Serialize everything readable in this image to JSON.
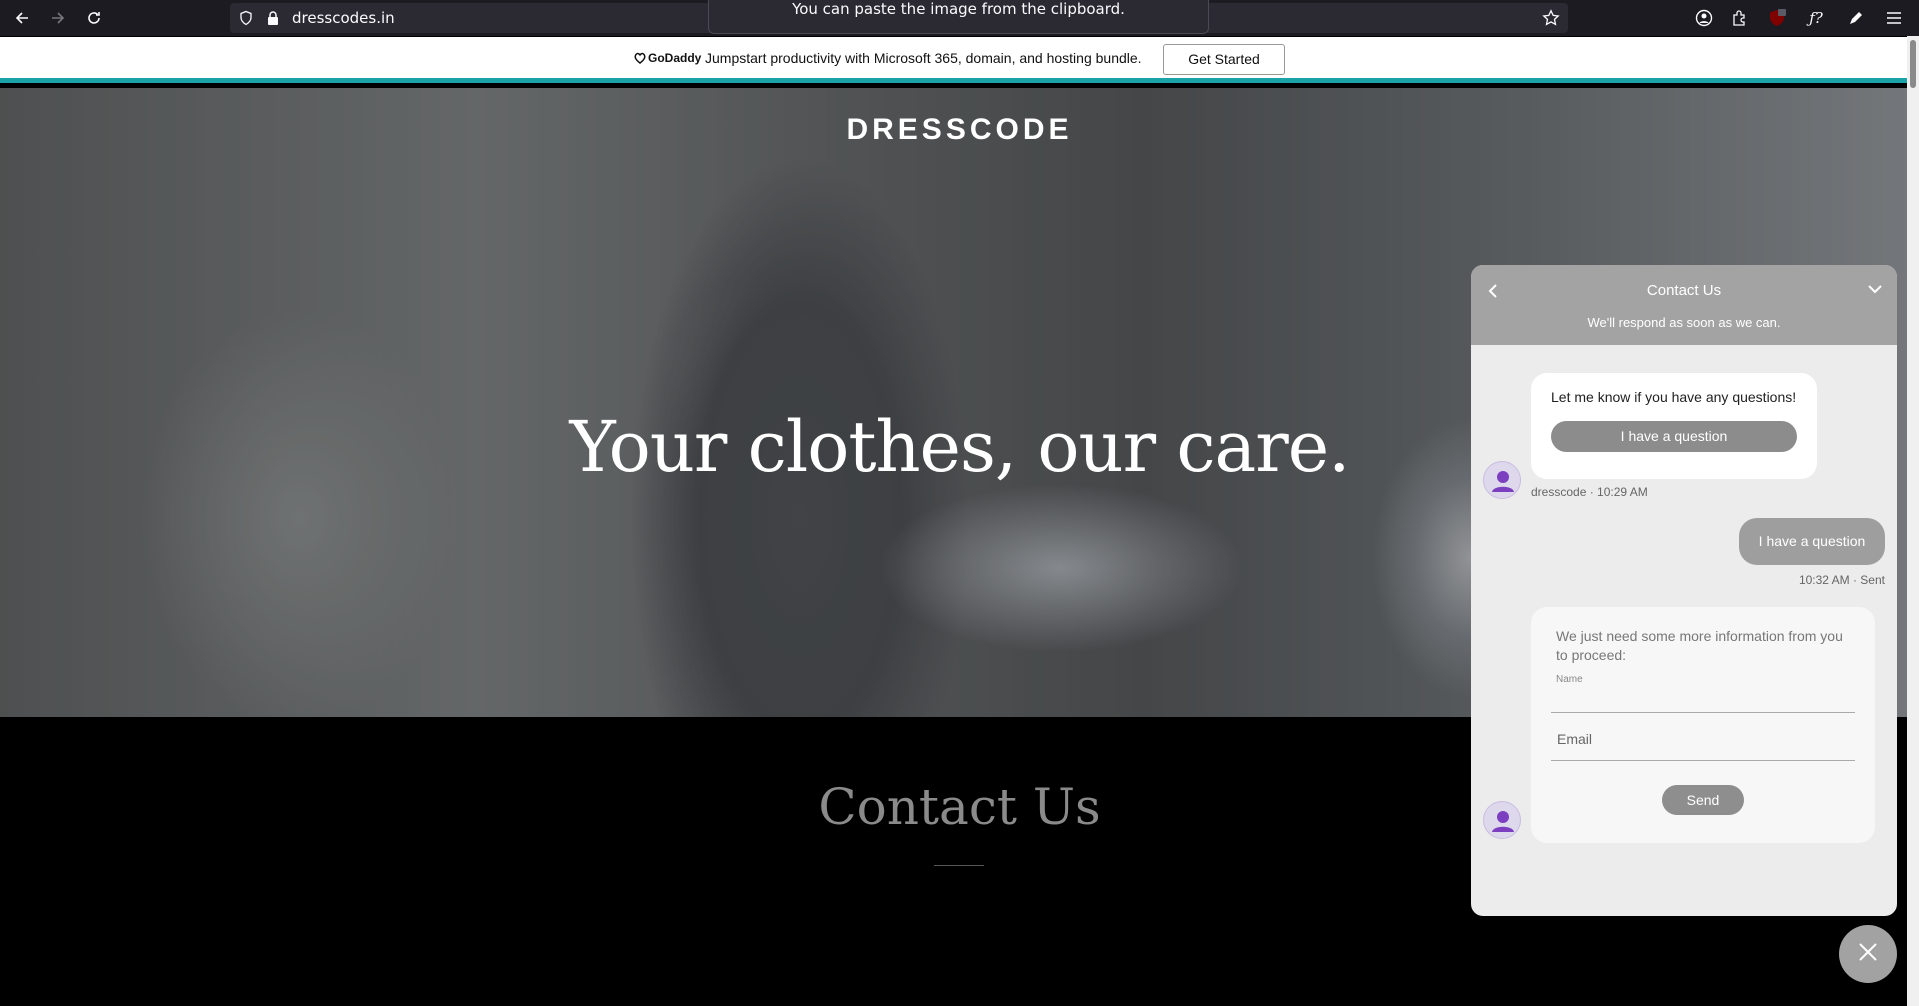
{
  "browser": {
    "url": "dresscodes.in",
    "clipboard_toast": "You can paste the image from the clipboard."
  },
  "promo": {
    "logo_text": "GoDaddy",
    "message": "Jumpstart productivity with Microsoft 365, domain, and hosting bundle.",
    "button_label": "Get Started",
    "accent_color": "#1ba3a8"
  },
  "site": {
    "brand": "DRESSCODE",
    "tagline": "Your clothes, our care.",
    "contact_heading": "Contact Us"
  },
  "chat": {
    "header_title": "Contact Us",
    "header_subtitle": "We'll respond as soon as we can.",
    "bot_message": "Let me know if you have any questions!",
    "quick_reply": "I have a question",
    "bot_meta": "dresscode · 10:29 AM",
    "user_message": "I have a question",
    "user_meta": "10:32 AM · Sent",
    "form_intro": "We just need some more information from you to proceed:",
    "name_label": "Name",
    "email_placeholder": "Email",
    "send_label": "Send"
  }
}
